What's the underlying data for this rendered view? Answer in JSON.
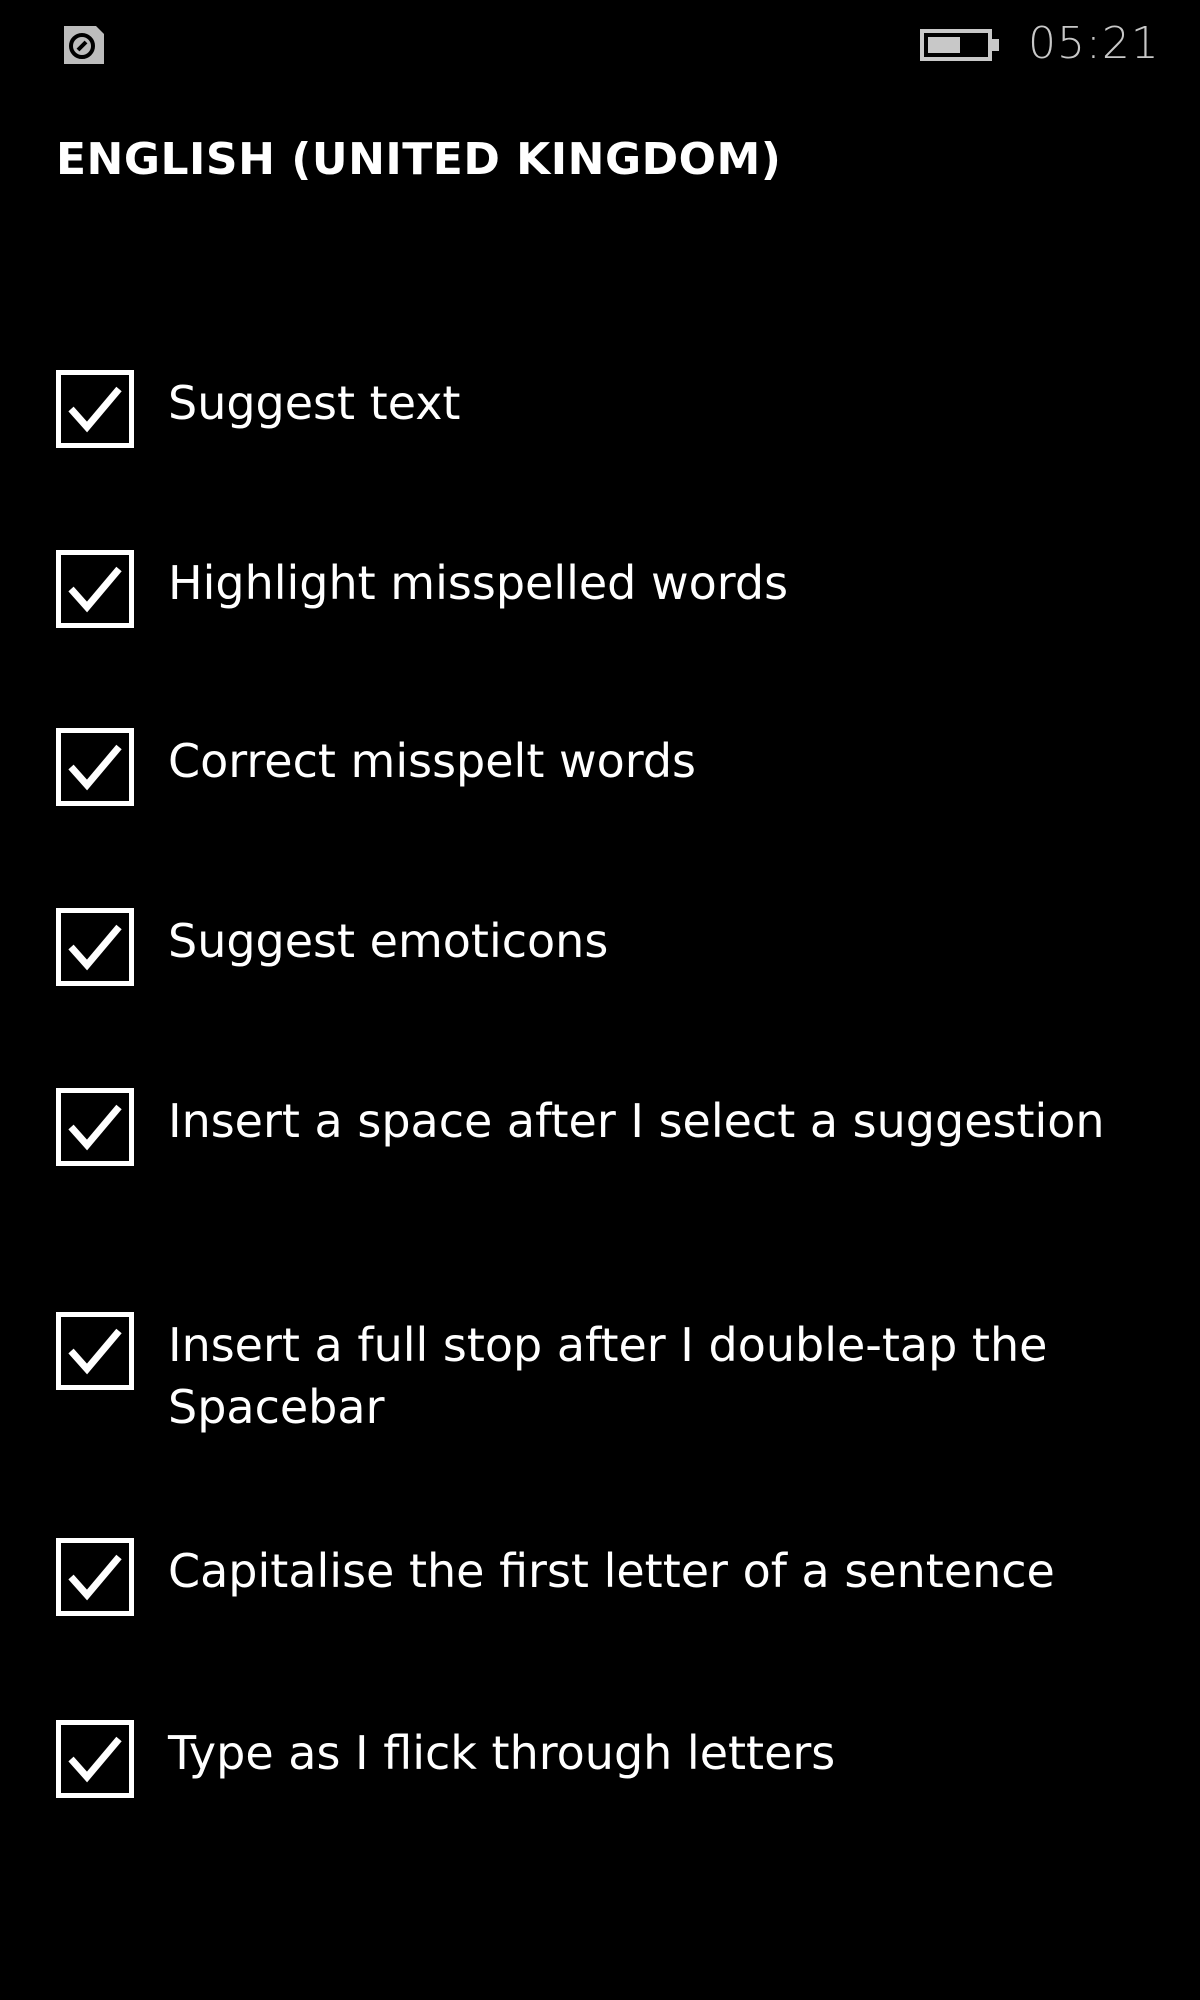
{
  "status_bar": {
    "app_icon": "sim-icon",
    "battery_icon": "battery-icon",
    "time": "05:21"
  },
  "page": {
    "title": "ENGLISH (UNITED KINGDOM)"
  },
  "options": [
    {
      "label": "Suggest text",
      "checked": true
    },
    {
      "label": "Highlight misspelled words",
      "checked": true
    },
    {
      "label": "Correct misspelt words",
      "checked": true
    },
    {
      "label": "Suggest emoticons",
      "checked": true
    },
    {
      "label": "Insert a space after I select a suggestion",
      "checked": true
    },
    {
      "label": "Insert a full stop after I double-tap the Spacebar",
      "checked": true
    },
    {
      "label": "Capitalise the first letter of a sentence",
      "checked": true
    },
    {
      "label": "Type as I flick through letters",
      "checked": true
    }
  ],
  "colors": {
    "background": "#000000",
    "foreground": "#ffffff",
    "clock": "#c8c8c8"
  }
}
